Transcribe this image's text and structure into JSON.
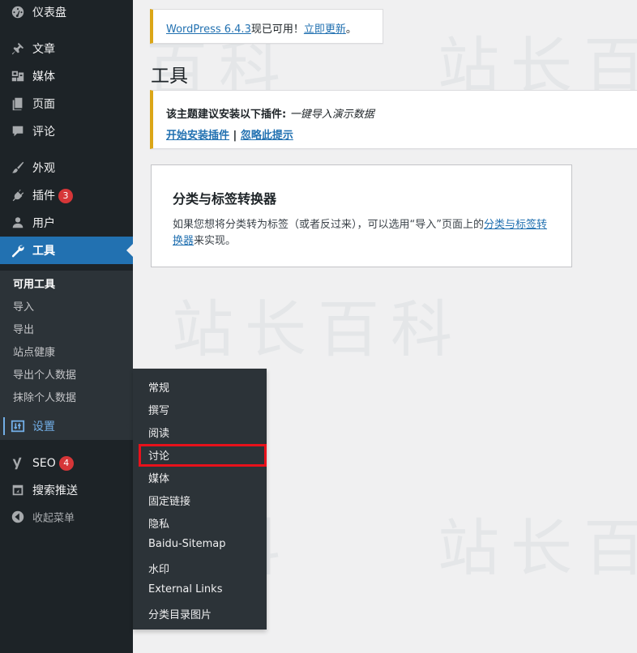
{
  "watermark": "站长百科",
  "sidebar": {
    "items": [
      {
        "label": "仪表盘",
        "icon": "dashboard-icon"
      },
      {
        "label": "文章",
        "icon": "pin-icon"
      },
      {
        "label": "媒体",
        "icon": "media-icon"
      },
      {
        "label": "页面",
        "icon": "pages-icon"
      },
      {
        "label": "评论",
        "icon": "comments-icon"
      },
      {
        "label": "外观",
        "icon": "brush-icon"
      },
      {
        "label": "插件",
        "icon": "plugin-icon",
        "badge": "3"
      },
      {
        "label": "用户",
        "icon": "users-icon"
      },
      {
        "label": "工具",
        "icon": "wrench-icon"
      },
      {
        "label": "设置",
        "icon": "settings-icon"
      },
      {
        "label": "SEO",
        "icon": "yoast-icon",
        "badge": "4"
      },
      {
        "label": "搜索推送",
        "icon": "external-icon"
      },
      {
        "label": "收起菜单",
        "icon": "collapse-icon"
      }
    ],
    "tools_submenu": [
      "可用工具",
      "导入",
      "导出",
      "站点健康",
      "导出个人数据",
      "抹除个人数据"
    ]
  },
  "flyout": {
    "items": [
      "常规",
      "撰写",
      "阅读",
      "讨论",
      "媒体",
      "固定链接",
      "隐私",
      "Baidu-Sitemap",
      "水印",
      "External Links",
      "分类目录图片"
    ],
    "highlighted": "讨论"
  },
  "update_notice": {
    "link": "WordPress 6.4.3",
    "text": "现已可用！",
    "update_link": "立即更新",
    "end": "。"
  },
  "page_title": "工具",
  "plugin_notice": {
    "text": "该主题建议安装以下插件: ",
    "plugin": "一键导入演示数据",
    "install_link": "开始安装插件",
    "separator": " | ",
    "dismiss_link": "忽略此提示"
  },
  "card": {
    "title": "分类与标签转换器",
    "desc_before": "如果您想将分类转为标签（或者反过来），可以选用“导入”页面上的",
    "desc_link": "分类与标签转换器",
    "desc_after": "来实现。"
  },
  "colors": {
    "menu_bg": "#1d2327",
    "submenu_bg": "#2c3338",
    "accent": "#2271b1",
    "hover_link": "#72aee6",
    "badge": "#d63638",
    "notice_warning": "#dba617",
    "highlight_box": "#e8111b"
  }
}
